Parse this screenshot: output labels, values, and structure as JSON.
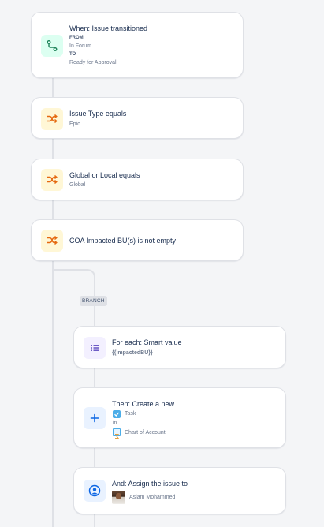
{
  "trigger": {
    "title": "When: Issue transitioned",
    "from_label": "FROM",
    "from_value": "In Forum",
    "to_label": "TO",
    "to_value": "Ready for Approval",
    "icon": "transition-icon"
  },
  "conditions": [
    {
      "title": "Issue Type equals",
      "value": "Epic",
      "icon": "shuffle-icon"
    },
    {
      "title": "Global or Local equals",
      "value": "Global",
      "icon": "shuffle-icon"
    },
    {
      "title": "COA Impacted BU(s) is not empty",
      "icon": "shuffle-icon"
    }
  ],
  "branch": {
    "label": "BRANCH",
    "for_each": {
      "title": "For each: Smart value",
      "value": "{{ImpactedBU}}",
      "icon": "list-icon"
    },
    "create": {
      "title": "Then: Create a new",
      "issue_type": "Task",
      "in_label": "in",
      "project": "Chart of Account",
      "icon": "plus-icon"
    },
    "assign": {
      "title": "And: Assign the issue to",
      "assignee": "Aslam Mohammed",
      "icon": "user-circle-icon"
    }
  },
  "colors": {
    "background": "#f4f5f7",
    "card_border": "#dfe1e6",
    "trigger_icon_bg": "#dcfff1",
    "trigger_icon": "#1f845a",
    "condition_icon_bg": "#fff7d6",
    "condition_icon": "#e56910",
    "branch_icon_bg": "#f3f0ff",
    "branch_icon": "#6e5dc6",
    "action_icon_bg": "#e9f2ff",
    "action_icon": "#0c66e4"
  }
}
